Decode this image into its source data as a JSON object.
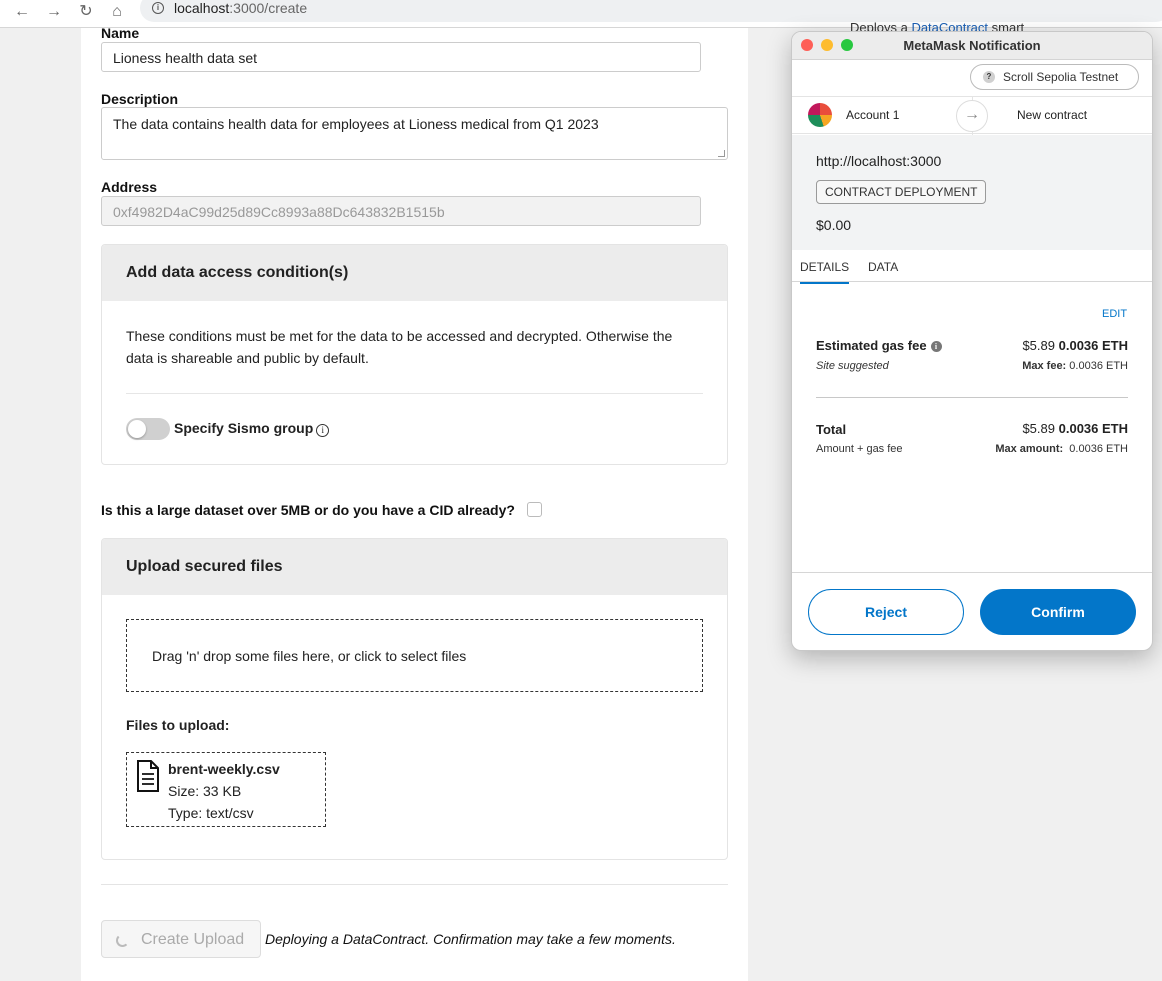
{
  "browser": {
    "url_host": "localhost",
    "url_rest": ":3000/create"
  },
  "form": {
    "name_label": "Name",
    "name_value": "Lioness health data set",
    "description_label": "Description",
    "description_value": "The data contains health data for employees at Lioness medical from Q1 2023",
    "address_label": "Address",
    "address_value": "0xf4982D4aC99d25d89Cc8993a88Dc643832B1515b"
  },
  "access_card": {
    "title": "Add data access condition(s)",
    "text": "These conditions must be met for the data to be accessed and decrypted. Otherwise the data is shareable and public by default.",
    "toggle_label": "Specify Sismo group",
    "toggle_on": false
  },
  "large_dataset_question": "Is this a large dataset over 5MB or do you have a CID already?",
  "upload_card": {
    "title": "Upload secured files",
    "dropzone_text": "Drag 'n' drop some files here, or click to select files",
    "files_label": "Files to upload:",
    "file": {
      "name": "brent-weekly.csv",
      "size": "Size: 33 KB",
      "type": "Type: text/csv"
    }
  },
  "footer": {
    "create_button": "Create Upload",
    "deploy_message": "Deploying a DataContract. Confirmation may take a few moments."
  },
  "background_snippet": {
    "text": "Deploys a",
    "link": "DataContract",
    "after": "smart"
  },
  "metamask": {
    "title": "MetaMask Notification",
    "network": "Scroll Sepolia Testnet",
    "account": "Account 1",
    "new_contract": "New contract",
    "origin": "http://localhost:3000",
    "badge": "CONTRACT DEPLOYMENT",
    "amount": "$0.00",
    "tabs": [
      "DETAILS",
      "DATA"
    ],
    "edit": "EDIT",
    "gas_label": "Estimated gas fee",
    "gas_usd": "$5.89",
    "gas_eth": "0.0036 ETH",
    "site_suggested": "Site suggested",
    "max_fee_label": "Max fee:",
    "max_fee_value": "0.0036 ETH",
    "total_label": "Total",
    "total_usd": "$5.89",
    "total_eth": "0.0036 ETH",
    "amount_gas": "Amount + gas fee",
    "max_amount_label": "Max amount:",
    "max_amount_value": "0.0036 ETH",
    "reject": "Reject",
    "confirm": "Confirm",
    "colors": {
      "primary": "#0376c9"
    }
  }
}
